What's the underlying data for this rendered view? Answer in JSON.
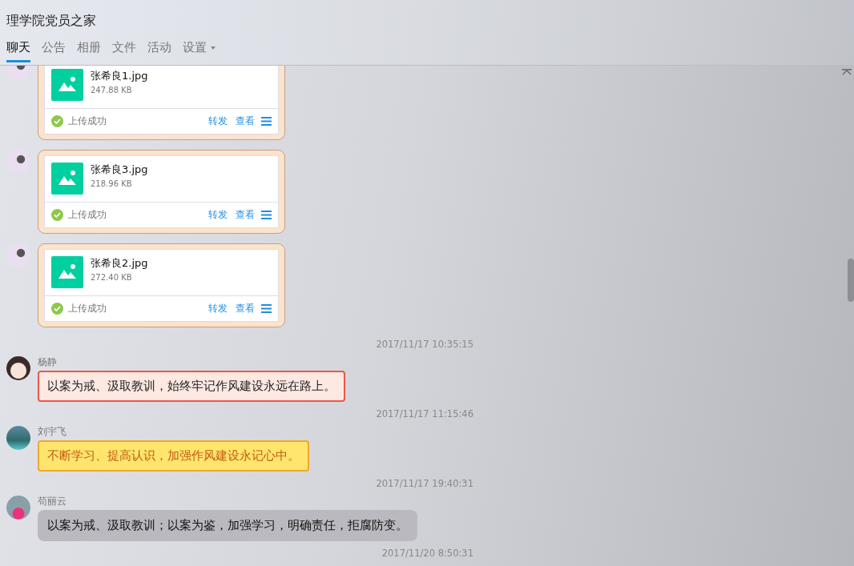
{
  "window": {
    "title": "理学院党员之家"
  },
  "tabs": [
    {
      "label": "聊天",
      "selected": true,
      "dropdown": false
    },
    {
      "label": "公告",
      "selected": false,
      "dropdown": false
    },
    {
      "label": "相册",
      "selected": false,
      "dropdown": false
    },
    {
      "label": "文件",
      "selected": false,
      "dropdown": false
    },
    {
      "label": "活动",
      "selected": false,
      "dropdown": false
    },
    {
      "label": "设置",
      "selected": false,
      "dropdown": true
    }
  ],
  "messages": [
    {
      "kind": "file",
      "file_name": "张希良1.jpg",
      "size": "247.88 KB",
      "status": "上传成功",
      "actions": [
        "转发",
        "查看"
      ]
    },
    {
      "kind": "file",
      "file_name": "张希良3.jpg",
      "size": "218.96 KB",
      "status": "上传成功",
      "actions": [
        "转发",
        "查看"
      ]
    },
    {
      "kind": "file",
      "file_name": "张希良2.jpg",
      "size": "272.40 KB",
      "status": "上传成功",
      "actions": [
        "转发",
        "查看"
      ]
    },
    {
      "kind": "time",
      "text": "2017/11/17 10:35:15"
    },
    {
      "kind": "festive",
      "sender": "杨静",
      "text": "以案为戒、汲取教训，始终牢记作风建设永远在路上。"
    },
    {
      "kind": "time",
      "text": "2017/11/17 11:15:46"
    },
    {
      "kind": "golden",
      "sender": "刘宇飞",
      "text": "不断学习、提高认识，加强作风建设永记心中。"
    },
    {
      "kind": "time",
      "text": "2017/11/17 19:40:31"
    },
    {
      "kind": "text",
      "sender": "苟丽云",
      "text": "以案为戒、汲取教训；以案为鉴，加强学习，明确责任，拒腐防变。"
    },
    {
      "kind": "time",
      "text": "2017/11/20 8:50:31"
    }
  ]
}
